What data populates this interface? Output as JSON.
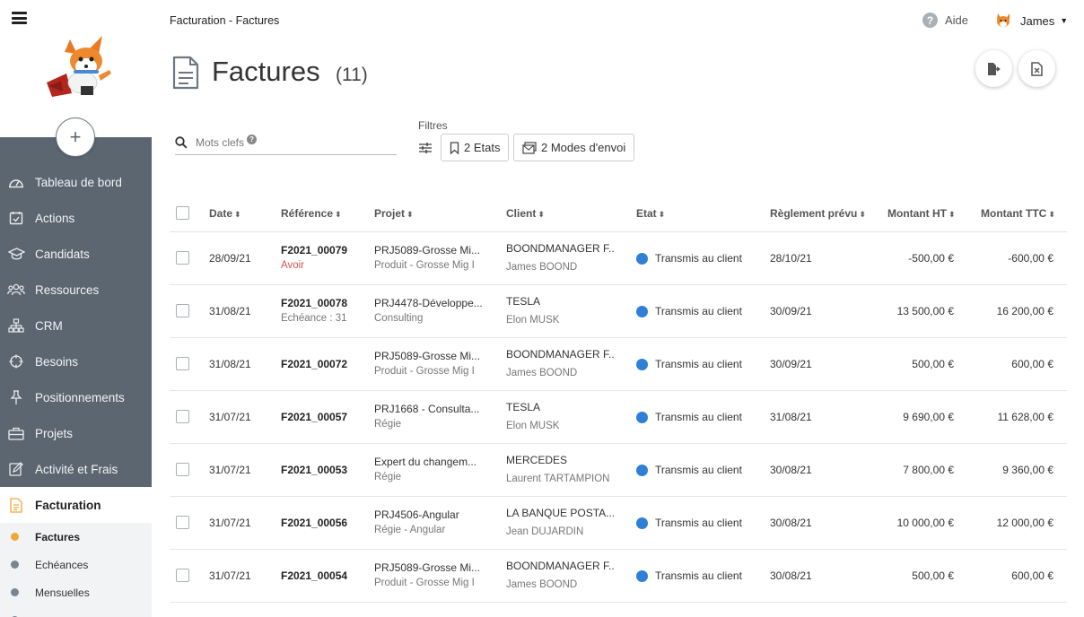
{
  "sidebar": {
    "add_label": "+",
    "items": [
      {
        "label": "Tableau de bord",
        "icon": "gauge-icon"
      },
      {
        "label": "Actions",
        "icon": "calendar-check-icon"
      },
      {
        "label": "Candidats",
        "icon": "graduation-cap-icon"
      },
      {
        "label": "Ressources",
        "icon": "people-icon"
      },
      {
        "label": "CRM",
        "icon": "sitemap-icon"
      },
      {
        "label": "Besoins",
        "icon": "crosshair-icon"
      },
      {
        "label": "Positionnements",
        "icon": "pin-icon"
      },
      {
        "label": "Projets",
        "icon": "briefcase-icon"
      },
      {
        "label": "Activité et Frais",
        "icon": "edit-icon"
      },
      {
        "label": "Facturation",
        "icon": "invoice-icon"
      }
    ],
    "subitems": [
      {
        "label": "Factures"
      },
      {
        "label": "Echéances"
      },
      {
        "label": "Mensuelles"
      }
    ]
  },
  "header": {
    "breadcrumb": "Facturation - Factures",
    "help_label": "Aide",
    "user_name": "James"
  },
  "page": {
    "title": "Factures",
    "count": "(11)"
  },
  "search": {
    "placeholder": "Mots clefs"
  },
  "filters": {
    "label": "Filtres",
    "etats": "2 Etats",
    "modes": "2 Modes d'envoi"
  },
  "table": {
    "columns": {
      "date": "Date",
      "reference": "Référence",
      "projet": "Projet",
      "client": "Client",
      "etat": "Etat",
      "reglement": "Règlement prévu",
      "ht": "Montant HT",
      "ttc": "Montant TTC"
    },
    "rows": [
      {
        "date": "28/09/21",
        "ref": "F2021_00079",
        "ref_sub": "Avoir",
        "projet": "PRJ5089-Grosse Mi...",
        "projet_sub": "Produit  - Grosse Mig I",
        "client": "BOONDMANAGER F...",
        "client_sub": "James BOOND",
        "etat": "Transmis au client",
        "reglement": "28/10/21",
        "ht": "-500,00 €",
        "ttc": "-600,00 €"
      },
      {
        "date": "31/08/21",
        "ref": "F2021_00078",
        "ref_sub": "Echéance : 31",
        "projet": "PRJ4478-Développe...",
        "projet_sub": "Consulting",
        "client": "TESLA",
        "client_sub": "Elon MUSK",
        "etat": "Transmis au client",
        "reglement": "30/09/21",
        "ht": "13 500,00 €",
        "ttc": "16 200,00 €"
      },
      {
        "date": "31/08/21",
        "ref": "F2021_00072",
        "ref_sub": "",
        "projet": "PRJ5089-Grosse Mi...",
        "projet_sub": "Produit  - Grosse Mig I",
        "client": "BOONDMANAGER F...",
        "client_sub": "James BOOND",
        "etat": "Transmis au client",
        "reglement": "30/09/21",
        "ht": "500,00 €",
        "ttc": "600,00 €"
      },
      {
        "date": "31/07/21",
        "ref": "F2021_00057",
        "ref_sub": "",
        "projet": "PRJ1668 - Consulta...",
        "projet_sub": "Régie",
        "client": "TESLA",
        "client_sub": "Elon MUSK",
        "etat": "Transmis au client",
        "reglement": "31/08/21",
        "ht": "9 690,00 €",
        "ttc": "11 628,00 €"
      },
      {
        "date": "31/07/21",
        "ref": "F2021_00053",
        "ref_sub": "",
        "projet": "Expert du changem...",
        "projet_sub": "Régie",
        "client": "MERCEDES",
        "client_sub": "Laurent TARTAMPION",
        "etat": "Transmis au client",
        "reglement": "30/08/21",
        "ht": "7 800,00 €",
        "ttc": "9 360,00 €"
      },
      {
        "date": "31/07/21",
        "ref": "F2021_00056",
        "ref_sub": "",
        "projet": "PRJ4506-Angular",
        "projet_sub": "Régie  - Angular",
        "client": "LA BANQUE POSTA...",
        "client_sub": "Jean DUJARDIN",
        "etat": "Transmis au client",
        "reglement": "30/08/21",
        "ht": "10 000,00 €",
        "ttc": "12 000,00 €"
      },
      {
        "date": "31/07/21",
        "ref": "F2021_00054",
        "ref_sub": "",
        "projet": "PRJ5089-Grosse Mi...",
        "projet_sub": "Produit  - Grosse Mig I",
        "client": "BOONDMANAGER F...",
        "client_sub": "James BOOND",
        "etat": "Transmis au client",
        "reglement": "30/08/21",
        "ht": "500,00 €",
        "ttc": "600,00 €"
      }
    ]
  },
  "colors": {
    "sidebar_bg": "#5c6670",
    "accent": "#f0a830",
    "status_blue": "#2f7fd6",
    "avoir_red": "#e05050"
  }
}
